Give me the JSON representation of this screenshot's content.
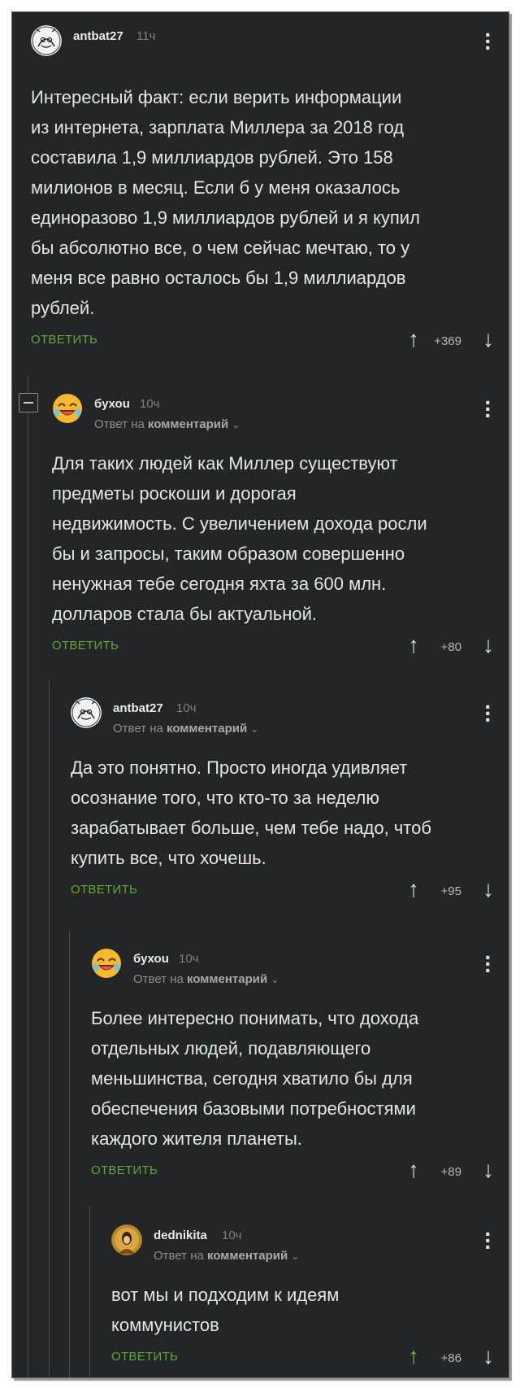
{
  "comments": [
    {
      "username": "antbat27",
      "time": "11ч",
      "reply_prefix": "",
      "reply_target": "",
      "lines": [
        "Интересный факт: если верить информации",
        "из интернета, зарплата Миллера за 2018 год",
        "составила 1,9 миллиардов рублей. Это 158",
        "милионов в месяц. Если б у меня оказалось",
        "единоразово 1,9 миллиардов рублей и я купил",
        "бы абсолютно все, о чем сейчас мечтаю, то у",
        "меня все равно осталось бы 1,9 миллиардов",
        "рублей."
      ],
      "reply_label": "ОТВЕТИТЬ",
      "score": "+369",
      "avatar": "cartoon-avatar"
    },
    {
      "username": "бухоu",
      "time": "10ч",
      "reply_prefix": "Ответ на",
      "reply_target": "комментарий",
      "lines": [
        "Для таких людей как Миллер существуют",
        "предметы роскоши и дорогая",
        "недвижимость. С увеличением дохода росли",
        "бы и запросы, таким образом совершенно",
        "ненужная тебе сегодня яхта за 600 млн.",
        "долларов стала бы актуальной."
      ],
      "reply_label": "ОТВЕТИТЬ",
      "score": "+80",
      "avatar": "laughing-emoji-avatar"
    },
    {
      "username": "antbat27",
      "time": "10ч",
      "reply_prefix": "Ответ на",
      "reply_target": "комментарий",
      "lines": [
        "Да это понятно. Просто иногда удивляет",
        "осознание того, что кто-то за неделю",
        "зарабатывает больше, чем тебе надо, чтоб",
        "купить все, что хочешь."
      ],
      "reply_label": "ОТВЕТИТЬ",
      "score": "+95",
      "avatar": "cartoon-avatar"
    },
    {
      "username": "бухоu",
      "time": "10ч",
      "reply_prefix": "Ответ на",
      "reply_target": "комментарий",
      "lines": [
        "Более интересно понимать, что дохода",
        "отдельных людей, подавляющего",
        "меньшинства, сегодня хватило бы для",
        "обеспечения базовыми потребностями",
        "каждого жителя планеты."
      ],
      "reply_label": "ОТВЕТИТЬ",
      "score": "+89",
      "avatar": "laughing-emoji-avatar"
    },
    {
      "username": "dednikita",
      "time": "10ч",
      "reply_prefix": "Ответ на",
      "reply_target": "комментарий",
      "lines": [
        "вот мы и подходим к идеям",
        "коммунистов"
      ],
      "reply_label": "ОТВЕТИТЬ",
      "score": "+86",
      "avatar": "portrait-avatar"
    }
  ],
  "colors": {
    "background": "#242527",
    "reply_green": "#5fa73a",
    "upvoted_green": "#67b94a"
  }
}
